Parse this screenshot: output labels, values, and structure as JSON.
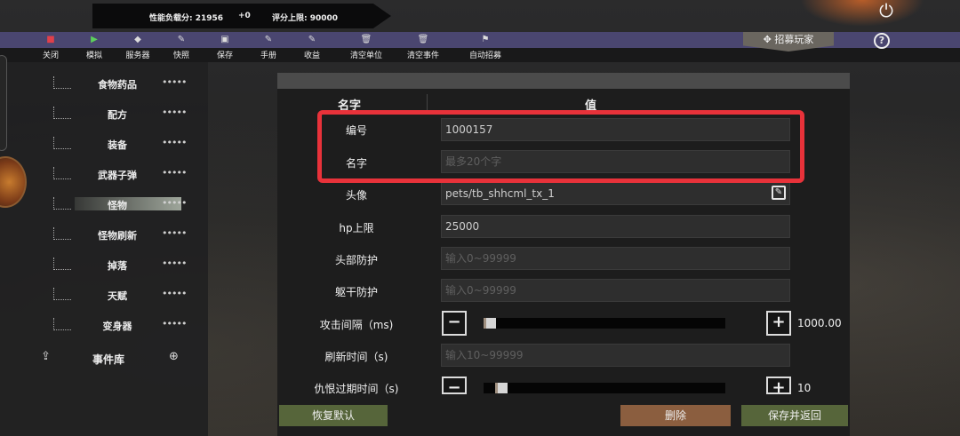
{
  "status": {
    "perf_label": "性能负载分: 21956",
    "perf_delta": "+0",
    "score_label": "评分上限: 90000"
  },
  "toolbar": [
    {
      "icon": "stop-icon",
      "glyph": "■",
      "label": "关闭",
      "color": "#e0404a"
    },
    {
      "icon": "play-icon",
      "glyph": "▶",
      "label": "模拟",
      "color": "#5cd05c"
    },
    {
      "icon": "cube-icon",
      "glyph": "◆",
      "label": "服务器",
      "color": "#dcdcdc"
    },
    {
      "icon": "edit-icon",
      "glyph": "✎",
      "label": "快照",
      "color": "#dcdcdc"
    },
    {
      "icon": "save-icon",
      "glyph": "▣",
      "label": "保存",
      "color": "#dcdcdc"
    },
    {
      "icon": "manual-icon",
      "glyph": "✎",
      "label": "手册",
      "color": "#dcdcdc"
    },
    {
      "icon": "income-icon",
      "glyph": "✎",
      "label": "收益",
      "color": "#dcdcdc"
    },
    {
      "icon": "trash-icon",
      "glyph": "🗑",
      "label": "清空单位",
      "color": "#dcdcdc"
    },
    {
      "icon": "trash-icon",
      "glyph": "🗑",
      "label": "清空事件",
      "color": "#dcdcdc"
    },
    {
      "icon": "recruit-auto-icon",
      "glyph": "⚑",
      "label": "自动招募",
      "color": "#dcdcdc"
    }
  ],
  "recruit_label": "招募玩家",
  "help_label": "?",
  "sidebar": {
    "items": [
      {
        "label": "食物药品",
        "more": "•••••"
      },
      {
        "label": "配方",
        "more": "•••••"
      },
      {
        "label": "装备",
        "more": "•••••"
      },
      {
        "label": "武器子弹",
        "more": "•••••"
      },
      {
        "label": "怪物",
        "more": "•••••"
      },
      {
        "label": "怪物刷新",
        "more": "•••••"
      },
      {
        "label": "掉落",
        "more": "•••••"
      },
      {
        "label": "天赋",
        "more": "•••••"
      },
      {
        "label": "变身器",
        "more": "•••••"
      }
    ],
    "event_library": "事件库"
  },
  "dialog": {
    "col_name": "名字",
    "col_value": "值",
    "rows": {
      "id": {
        "label": "编号",
        "value": "1000157"
      },
      "name": {
        "label": "名字",
        "placeholder": "最多20个字"
      },
      "avatar": {
        "label": "头像",
        "value": "pets/tb_shhcml_tx_1"
      },
      "hp": {
        "label": "hp上限",
        "value": "25000"
      },
      "head_armor": {
        "label": "头部防护",
        "placeholder": "输入0~99999"
      },
      "body_armor": {
        "label": "躯干防护",
        "placeholder": "输入0~99999"
      },
      "attack_interval": {
        "label": "攻击间隔（ms)",
        "value": "1000.00",
        "fraction": 0.0
      },
      "refresh_time": {
        "label": "刷新时间（s)",
        "placeholder": "输入10~99999"
      },
      "hate_expire": {
        "label": "仇恨过期时间（s)",
        "value": "10",
        "fraction": 0.05
      }
    },
    "buttons": {
      "reset": "恢复默认",
      "delete": "删除",
      "save_return": "保存并返回"
    }
  }
}
